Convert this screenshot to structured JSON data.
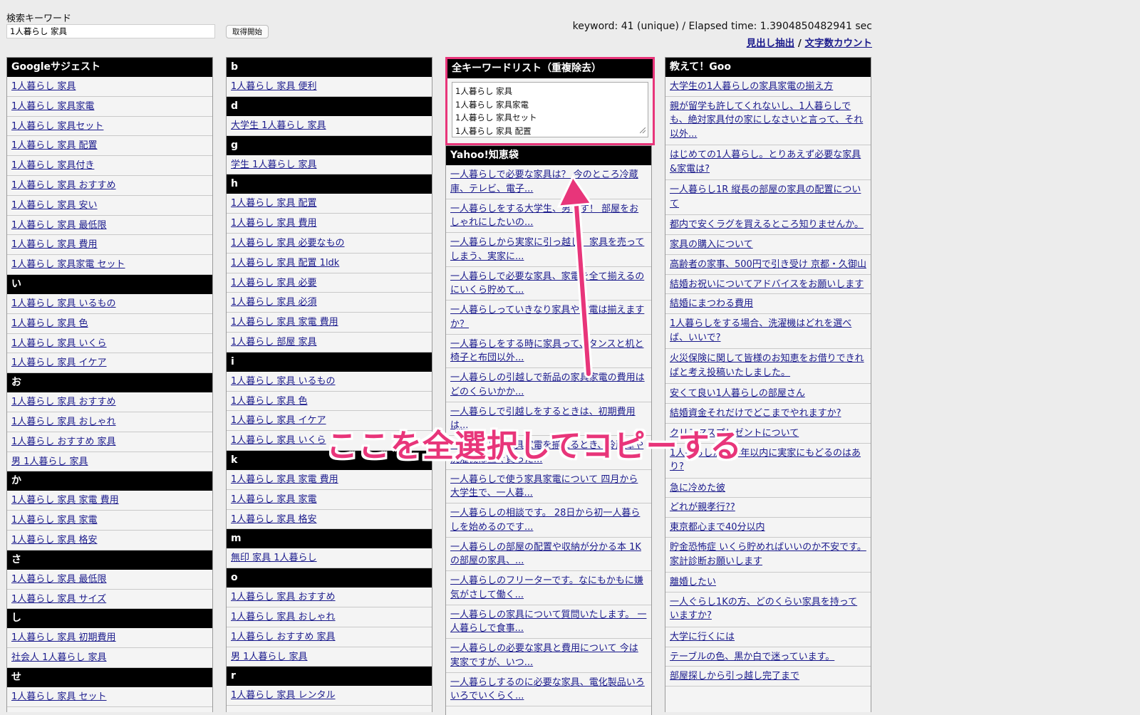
{
  "header": {
    "search_label": "検索キーワード",
    "search_value": "1人暮らし 家具",
    "fetch_button": "取得開始",
    "stats": "keyword: 41 (unique) / Elapsed time: 1.3904850482941 sec",
    "link_headings": "見出し抽出",
    "link_separator": " / ",
    "link_charcount": "文字数カウント"
  },
  "col1": {
    "sections": [
      {
        "title": "Googleサジェスト",
        "items": [
          "1人暮らし 家具",
          "1人暮らし 家具家電",
          "1人暮らし 家具セット",
          "1人暮らし 家具 配置",
          "1人暮らし 家具付き",
          "1人暮らし 家具 おすすめ",
          "1人暮らし 家具 安い",
          "1人暮らし 家具 最低限",
          "1人暮らし 家具 費用",
          "1人暮らし 家具家電 セット"
        ]
      },
      {
        "title": "い",
        "items": [
          "1人暮らし 家具 いるもの",
          "1人暮らし 家具 色",
          "1人暮らし 家具 いくら",
          "1人暮らし 家具 イケア"
        ]
      },
      {
        "title": "お",
        "items": [
          "1人暮らし 家具 おすすめ",
          "1人暮らし 家具 おしゃれ",
          "1人暮らし おすすめ 家具",
          "男 1人暮らし 家具"
        ]
      },
      {
        "title": "か",
        "items": [
          "1人暮らし 家具 家電 費用",
          "1人暮らし 家具 家電",
          "1人暮らし 家具 格安"
        ]
      },
      {
        "title": "さ",
        "items": [
          "1人暮らし 家具 最低限",
          "1人暮らし 家具 サイズ"
        ]
      },
      {
        "title": "し",
        "items": [
          "1人暮らし 家具 初期費用",
          "社会人 1人暮らし 家具"
        ]
      },
      {
        "title": "せ",
        "items": [
          "1人暮らし 家具 セット"
        ]
      }
    ]
  },
  "col2": {
    "sections": [
      {
        "title": "b",
        "items": [
          "1人暮らし 家具 便利"
        ]
      },
      {
        "title": "d",
        "items": [
          "大学生 1人暮らし 家具"
        ]
      },
      {
        "title": "g",
        "items": [
          "学生 1人暮らし 家具"
        ]
      },
      {
        "title": "h",
        "items": [
          "1人暮らし 家具 配置",
          "1人暮らし 家具 費用",
          "1人暮らし 家具 必要なもの",
          "1人暮らし 家具 配置 1ldk",
          "1人暮らし 家具 必要",
          "1人暮らし 家具 必須",
          "1人暮らし 家具 家電 費用",
          "1人暮らし 部屋 家具"
        ]
      },
      {
        "title": "i",
        "items": [
          "1人暮らし 家具 いるもの",
          "1人暮らし 家具 色",
          "1人暮らし 家具 イケア",
          "1人暮らし 家具 いくら"
        ]
      },
      {
        "title": "k",
        "items": [
          "1人暮らし 家具 家電 費用",
          "1人暮らし 家具 家電",
          "1人暮らし 家具 格安"
        ]
      },
      {
        "title": "m",
        "items": [
          "無印 家具 1人暮らし"
        ]
      },
      {
        "title": "o",
        "items": [
          "1人暮らし 家具 おすすめ",
          "1人暮らし 家具 おしゃれ",
          "1人暮らし おすすめ 家具",
          "男 1人暮らし 家具"
        ]
      },
      {
        "title": "r",
        "items": [
          "1人暮らし 家具 レンタル"
        ]
      }
    ]
  },
  "col3": {
    "dedup_title": "全キーワードリスト（重複除去）",
    "dedup_text": "1人暮らし 家具\n1人暮らし 家具家電\n1人暮らし 家具セット\n1人暮らし 家具 配置",
    "yahoo_title": "Yahoo!知恵袋",
    "yahoo_items": [
      "一人暮らしで必要な家具は？ 今のところ冷蔵庫、テレビ、電子...",
      "一人暮らしをする大学生、男です！ 部屋をおしゃれにしたいの...",
      "一人暮らしから実家に引っ越し：家具を売ってしまう、実家に...",
      "一人暮らしで必要な家具、家電を全て揃えるのにいくら貯めて...",
      "一人暮らしっていきなり家具や家電は揃えますか？",
      "一人暮らしをする時に家具って、タンスと机と椅子と布団以外...",
      "一人暮らしの引越しで新品の家具家電の費用はどのくらいかか...",
      "一人暮らしで引越しをするときは、初期費用は...",
      "一人暮らしで家具家電を揃えるとき、冷蔵庫や洗濯機は直ぐ買った...",
      "一人暮らしで使う家具家電について 四月から大学生で、一人暮...",
      "一人暮らしの相談です。 28日から初一人暮らしを始めるのです...",
      "一人暮らしの部屋の配置や収納が分かる本 1Kの部屋の家具、...",
      "一人暮らしのフリーターです。なにもかもに嫌気がさして働く...",
      "一人暮らしの家具について質問いたします。 一人暮らしで食事...",
      "一人暮らしの必要な家具と費用について 今は実家ですが、いつ...",
      "一人暮らしするのに必要な家具、電化製品いろいろでいくらく..."
    ]
  },
  "col4": {
    "title": "教えて！Goo",
    "items": [
      "大学生の1人暮らしの家具家電の揃え方",
      "親が留学も許してくれないし、1人暮らしでも、絶対家具付の家にしなさいと言って、それ以外...",
      "はじめての1人暮らし。とりあえず必要な家具&家電は?",
      "一人暮らし1R 縦長の部屋の家具の配置について",
      "都内で安くラグを買えるところ知りませんか。",
      "家具の購入について",
      "高齢者の家事、500円で引き受け 京都・久御山",
      "結婚お祝いについてアドバイスをお願いします",
      "結婚にまつわる費用",
      "1人暮らしをする場合、洗濯機はどれを選べば、いいで?",
      "火災保険に関して皆様のお知恵をお借りできればと考え投稿いたしました。",
      "安くて良い1人暮らしの部屋さん",
      "結婚資金それだけでどこまでやれますか?",
      "クリスマスプレゼントについて",
      "1人暮らしから半年以内に実家にもどるのはあり?",
      "急に冷めた彼",
      "どれが親孝行??",
      "東京都心まで40分以内",
      "貯金恐怖症 いくら貯めればいいのか不安です。家計診断お願いします",
      "離婚したい",
      "一人ぐらし1Kの方、どのくらい家具を持っていますか?",
      "大学に行くには",
      "テーブルの色、黒か白で迷っています。",
      "部屋探しから引っ越し完了まで"
    ]
  },
  "annotation": {
    "text": "ここを全選択してコピーする",
    "color": "#e8357a"
  }
}
